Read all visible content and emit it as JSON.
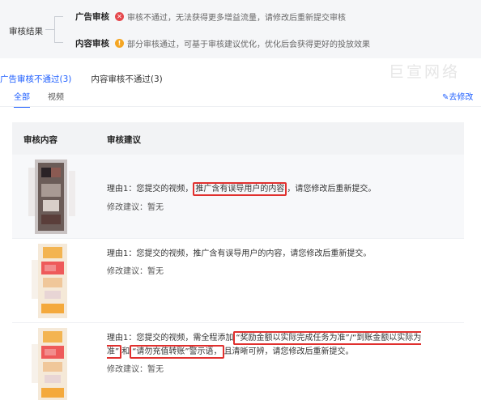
{
  "summary": {
    "label": "审核结果",
    "ad_review": {
      "category": "广告审核",
      "icon": "error-circle-icon",
      "desc": "审核不通过，无法获得更多增益流量，请修改后重新提交审核"
    },
    "content_review": {
      "category": "内容审核",
      "icon": "warning-circle-icon",
      "desc": "部分审核通过，可基于审核建议优化，优化后会获得更好的投放效果"
    }
  },
  "watermark": "巨宣网络",
  "tabs": [
    {
      "label": "广告审核不通过(3)",
      "active": true
    },
    {
      "label": "内容审核不通过(3)",
      "active": false
    }
  ],
  "subtabs": [
    {
      "label": "全部",
      "active": true
    },
    {
      "label": "视频",
      "active": false
    }
  ],
  "modify_link": "去修改",
  "table": {
    "headers": [
      "审核内容",
      "审核建议"
    ],
    "rows": [
      {
        "reason_prefix": "理由1：您提交的视频，",
        "reason_highlight": "推广含有误导用户的内容",
        "reason_suffix": "，请您修改后重新提交。",
        "suggestion": "修改建议：暂无"
      },
      {
        "reason": "理由1：您提交的视频，推广含有误导用户的内容，请您修改后重新提交。",
        "suggestion": "修改建议：暂无"
      },
      {
        "reason_prefix": "理由1：您提交的视频，需全程添加",
        "reason_highlight": "“奖励金额以实际完成任务为准”/“到账金额以实际为准”",
        "reason_mid": "和",
        "reason_highlight2": "“请勿充值转账”警示语，",
        "reason_suffix": "且清晰可辨，请您修改后重新提交。",
        "suggestion": "修改建议：暂无"
      }
    ]
  },
  "colors": {
    "accent": "#1f5fff",
    "error": "#e5484d",
    "warning": "#f5a623",
    "highlight_border": "#e0302e"
  }
}
